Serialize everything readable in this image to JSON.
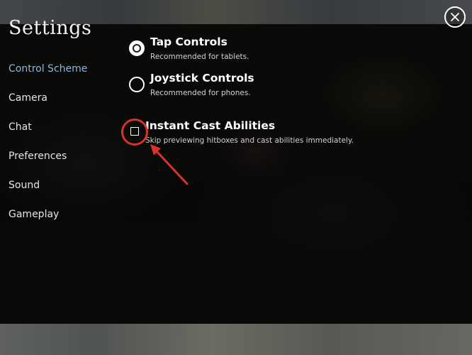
{
  "title": "Settings",
  "close_icon": "close-x-icon",
  "nav": {
    "items": [
      {
        "label": "Control Scheme",
        "active": true
      },
      {
        "label": "Camera",
        "active": false
      },
      {
        "label": "Chat",
        "active": false
      },
      {
        "label": "Preferences",
        "active": false
      },
      {
        "label": "Sound",
        "active": false
      },
      {
        "label": "Gameplay",
        "active": false
      }
    ]
  },
  "control_scheme": {
    "options": [
      {
        "label": "Tap Controls",
        "description": "Recommended for tablets.",
        "selected": true
      },
      {
        "label": "Joystick Controls",
        "description": "Recommended for phones.",
        "selected": false
      }
    ],
    "instant_cast": {
      "label": "Instant Cast Abilities",
      "description": "Skip previewing hitboxes and cast abilities immediately.",
      "checked": false
    }
  },
  "colors": {
    "active_nav": "#8fb6d8",
    "annotation": "#d8332a"
  }
}
